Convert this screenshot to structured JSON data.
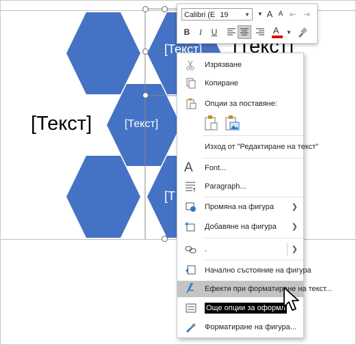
{
  "canvas": {
    "big_label": "[Текст]",
    "hex_label_center": "[Текст]",
    "hex_label_top": "[Текст]",
    "hex_label_bottom": "[Т",
    "right_label_partial": "[Текст]",
    "hex_color": "#4472c4"
  },
  "toolbar": {
    "font_name": "Calibri (E",
    "font_size": "19",
    "grow_font": "A",
    "shrink_font": "A",
    "bold": "B",
    "italic": "I",
    "underline": "U",
    "font_color": "A",
    "font_color_hex": "#e00000"
  },
  "menu": {
    "items": [
      {
        "label": "Изрязване"
      },
      {
        "label": "Копиране"
      },
      {
        "label": "Опции за поставяне:"
      },
      {
        "label": "Изход от \"Редактиране на текст\""
      },
      {
        "label": "Font..."
      },
      {
        "label": "Paragraph..."
      },
      {
        "label": "Промяна на фигура"
      },
      {
        "label": "Добавяне на фигура"
      },
      {
        "label": "."
      },
      {
        "label": "Начално състояние на фигура"
      },
      {
        "label": "Ефекти при форматиране на текст..."
      },
      {
        "label": "Още опции за оформл"
      },
      {
        "label": "Форматиране на фигура..."
      }
    ]
  }
}
